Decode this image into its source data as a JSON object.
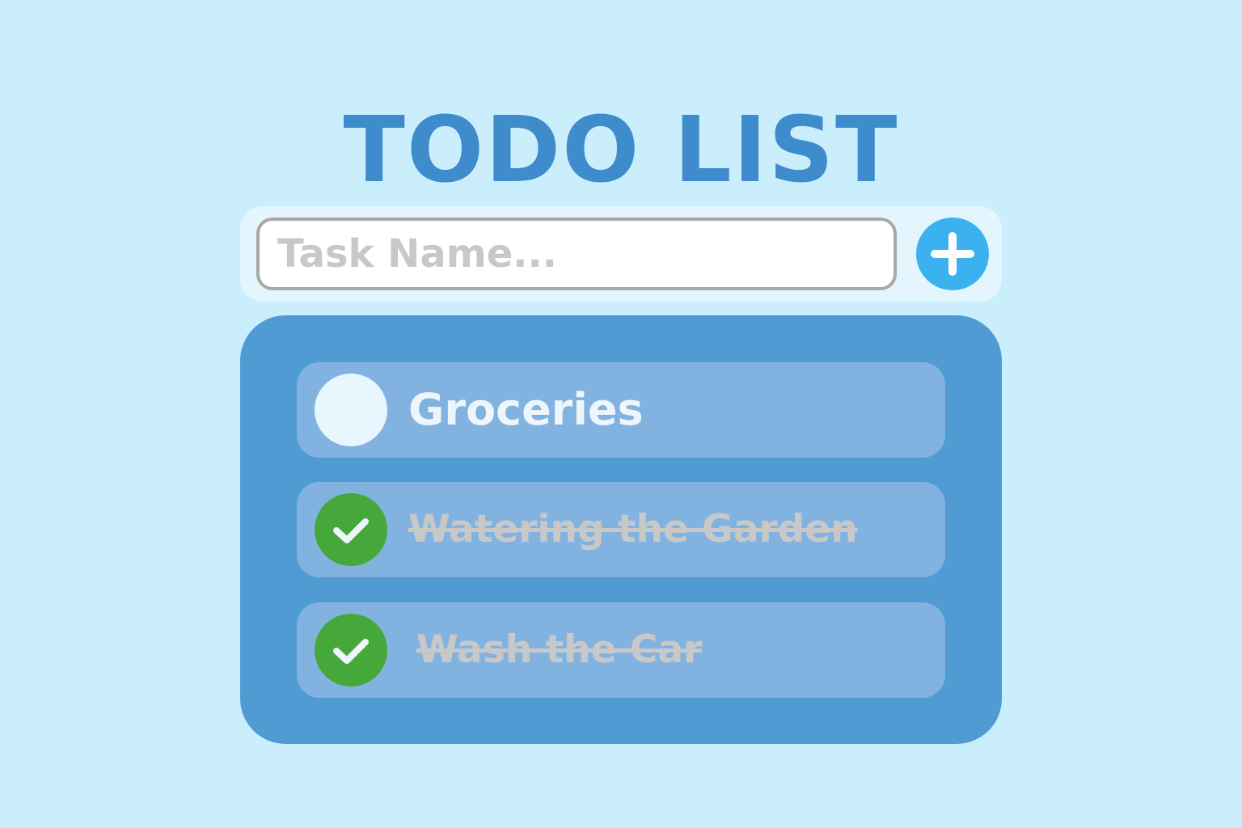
{
  "title": "TODO LIST",
  "input": {
    "placeholder": "Task Name...",
    "value": ""
  },
  "add_button": {
    "icon": "plus-icon"
  },
  "tasks": [
    {
      "label": "Groceries",
      "done": false
    },
    {
      "label": "Watering the Garden",
      "done": true
    },
    {
      "label": "Wash the Car",
      "done": true
    }
  ],
  "colors": {
    "background": "#cbeefd",
    "title": "#3e8ccb",
    "input_bar": "#e3f6fe",
    "add_button": "#3bb1f0",
    "list_panel": "#509bd4",
    "task_row": "#82b3e0",
    "checked": "#46a83a",
    "unchecked": "#e8f6fd",
    "done_text": "#c8c8c8"
  }
}
